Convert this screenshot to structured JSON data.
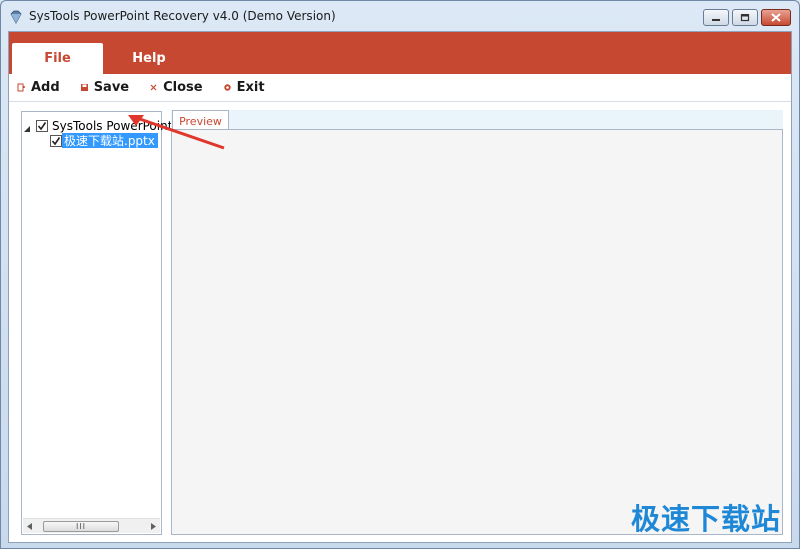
{
  "window": {
    "title": "SysTools PowerPoint Recovery v4.0 (Demo Version)",
    "icon": "app-diamond-icon"
  },
  "ribbon": {
    "tabs": [
      {
        "label": "File",
        "active": true
      },
      {
        "label": "Help",
        "active": false
      }
    ],
    "accent_color": "#c64831"
  },
  "toolbar": {
    "add_label": "Add",
    "save_label": "Save",
    "close_label": "Close",
    "exit_label": "Exit"
  },
  "tree": {
    "root": {
      "label": "SysTools PowerPoint",
      "checked": true,
      "expanded": true
    },
    "children": [
      {
        "label": "极速下载站.pptx",
        "checked": true,
        "selected": true
      }
    ],
    "scrollbar_thumb": "III"
  },
  "preview": {
    "tab_label": "Preview"
  },
  "watermark": {
    "text": "极速下载站"
  }
}
